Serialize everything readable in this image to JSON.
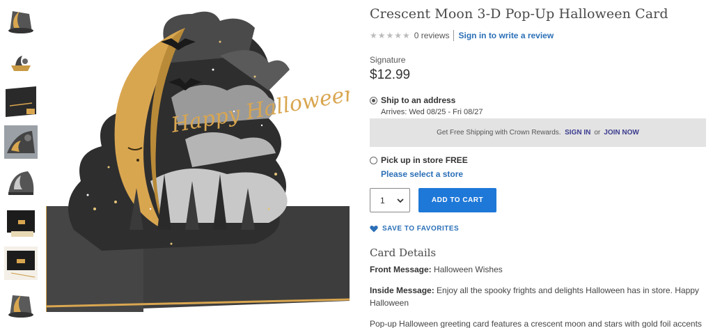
{
  "thumbnails": [
    {
      "name": "thumb-1"
    },
    {
      "name": "thumb-2"
    },
    {
      "name": "thumb-3"
    },
    {
      "name": "thumb-4"
    },
    {
      "name": "thumb-5"
    },
    {
      "name": "thumb-6"
    },
    {
      "name": "thumb-7"
    },
    {
      "name": "thumb-8"
    }
  ],
  "product": {
    "title": "Crescent Moon 3-D Pop-Up Halloween Card",
    "stars": "★★★★★",
    "review_count": "0 reviews",
    "write_review": "Sign in to write a review",
    "brand": "Signature",
    "price": "$12.99"
  },
  "shipping": {
    "ship_label": "Ship to an address",
    "arrives": "Arrives: Wed 08/25 - Fri 08/27",
    "promo_text": "Get Free Shipping with Crown Rewards.",
    "sign_in": "SIGN IN",
    "or": "or",
    "join_now": "JOIN NOW",
    "pickup_label": "Pick up in store FREE",
    "select_store": "Please select a store"
  },
  "cart": {
    "quantity": "1",
    "add_to_cart": "ADD TO CART",
    "save_favorites": "SAVE TO FAVORITES"
  },
  "details": {
    "heading": "Card Details",
    "front_label": "Front Message:",
    "front_value": "Halloween Wishes",
    "inside_label": "Inside Message:",
    "inside_value": "Enjoy all the spooky frights and delights Halloween has in store. Happy Halloween",
    "description": "Pop-up Halloween greeting card features a crescent moon and stars with gold foil accents"
  },
  "image_lettering": "Happy Halloween",
  "colors": {
    "link": "#2a6fb7",
    "button": "#1e78d8",
    "promo_bg": "#e3e3e3",
    "gold": "#d9a650",
    "card_dark": "#3a3a3a"
  }
}
